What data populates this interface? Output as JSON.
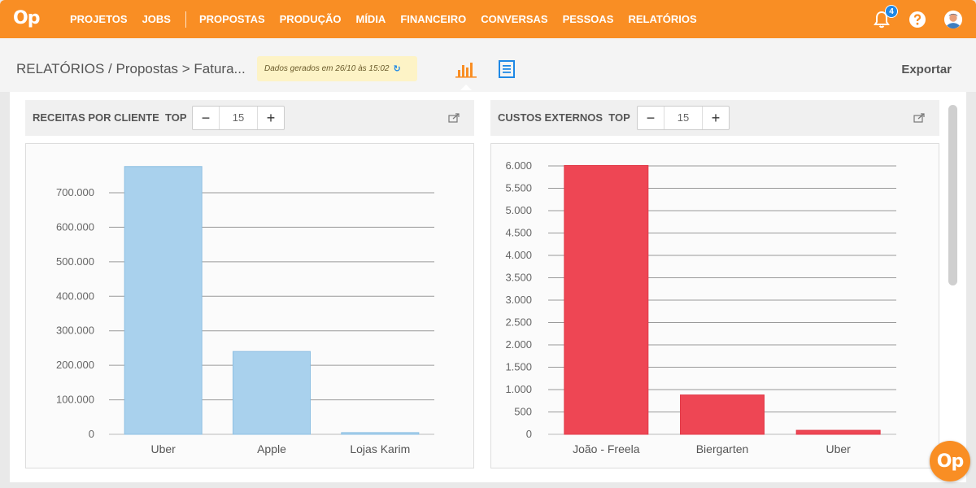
{
  "app": {
    "logo": "Op"
  },
  "nav": {
    "items": [
      "PROJETOS",
      "JOBS",
      "PROPOSTAS",
      "PRODUÇÃO",
      "MÍDIA",
      "FINANCEIRO",
      "CONVERSAS",
      "PESSOAS",
      "RELATÓRIOS"
    ],
    "notifications_count": "4"
  },
  "header": {
    "breadcrumb": "RELATÓRIOS / Propostas > Fatura...",
    "generated_stamp": "Dados gerados em 26/10 às 15:02",
    "export_label": "Exportar"
  },
  "colors": {
    "accent": "#f98e24",
    "bar_revenue": "#a9d1ed",
    "bar_costs": "#ee4654",
    "link": "#1e88e5"
  },
  "panels": [
    {
      "title": "RECEITAS POR CLIENTE",
      "top_label": "TOP",
      "top_value": "15"
    },
    {
      "title": "CUSTOS EXTERNOS",
      "top_label": "TOP",
      "top_value": "15"
    }
  ],
  "chart_data": [
    {
      "type": "bar",
      "title": "RECEITAS POR CLIENTE",
      "categories": [
        "Uber",
        "Apple",
        "Lojas Karim"
      ],
      "values": [
        776000,
        240000,
        5000
      ],
      "ylim": [
        0,
        700000
      ],
      "yticks": [
        0,
        100000,
        200000,
        300000,
        400000,
        500000,
        600000,
        700000
      ],
      "ytick_labels": [
        "0",
        "100.000",
        "200.000",
        "300.000",
        "400.000",
        "500.000",
        "600.000",
        "700.000"
      ],
      "grid": true
    },
    {
      "type": "bar",
      "title": "CUSTOS EXTERNOS",
      "categories": [
        "João - Freela",
        "Biergarten",
        "Uber"
      ],
      "values": [
        6010,
        880,
        90
      ],
      "ylim": [
        0,
        6000
      ],
      "yticks": [
        0,
        500,
        1000,
        1500,
        2000,
        2500,
        3000,
        3500,
        4000,
        4500,
        5000,
        5500,
        6000
      ],
      "ytick_labels": [
        "0",
        "500",
        "1.000",
        "1.500",
        "2.000",
        "2.500",
        "3.000",
        "3.500",
        "4.000",
        "4.500",
        "5.000",
        "5.500",
        "6.000"
      ],
      "grid": true
    }
  ]
}
